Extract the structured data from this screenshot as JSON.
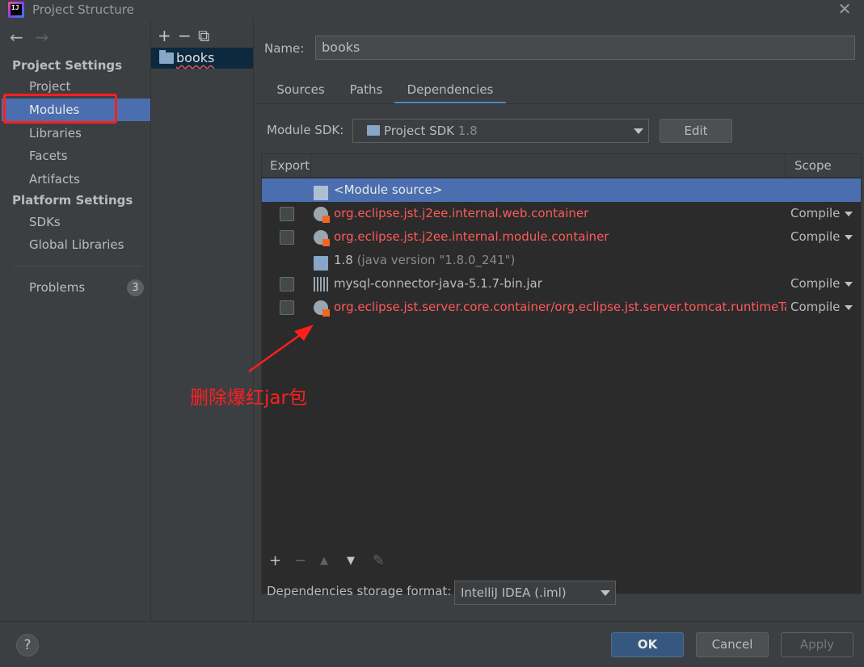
{
  "window": {
    "title": "Project Structure",
    "app_icon_text": "IJ"
  },
  "nav": {
    "back": "←",
    "forward": "→"
  },
  "sidebar": {
    "project_settings_header": "Project Settings",
    "platform_settings_header": "Platform Settings",
    "items": [
      {
        "label": "Project"
      },
      {
        "label": "Modules"
      },
      {
        "label": "Libraries"
      },
      {
        "label": "Facets"
      },
      {
        "label": "Artifacts"
      },
      {
        "label": "SDKs"
      },
      {
        "label": "Global Libraries"
      },
      {
        "label": "Problems"
      }
    ],
    "problems_count": "3"
  },
  "module_tree": {
    "toolbar": {
      "add": "+",
      "remove": "−",
      "copy": "⧉"
    },
    "items": [
      {
        "label": "books"
      }
    ]
  },
  "module": {
    "name_label": "Name:",
    "name_value": "books",
    "tabs": [
      {
        "label": "Sources"
      },
      {
        "label": "Paths"
      },
      {
        "label": "Dependencies"
      }
    ],
    "sdk_label": "Module SDK:",
    "sdk_value": "Project SDK",
    "sdk_version": "1.8",
    "edit_label": "Edit"
  },
  "deps_table": {
    "headers": {
      "export": "Export",
      "scope": "Scope"
    },
    "rows": [
      {
        "name": "<Module source>",
        "scope": ""
      },
      {
        "name": "org.eclipse.jst.j2ee.internal.web.container",
        "scope": "Compile"
      },
      {
        "name": "org.eclipse.jst.j2ee.internal.module.container",
        "scope": "Compile"
      },
      {
        "name": "1.8",
        "detail": "(java version \"1.8.0_241\")",
        "scope": ""
      },
      {
        "name": "mysql-connector-java-5.1.7-bin.jar",
        "scope": "Compile"
      },
      {
        "name": "org.eclipse.jst.server.core.container/org.eclipse.jst.server.tomcat.runtimeTarget",
        "scope": "Compile"
      }
    ],
    "toolbar": {
      "add": "+",
      "remove": "−",
      "up": "▲",
      "down": "▼",
      "edit": "✎"
    }
  },
  "storage": {
    "label": "Dependencies storage format:",
    "value": "IntelliJ IDEA (.iml)"
  },
  "annotation": {
    "text": "删除爆红jar包"
  },
  "buttons": {
    "help": "?",
    "ok": "OK",
    "cancel": "Cancel",
    "apply": "Apply"
  },
  "colors": {
    "selection": "#4b6eaf",
    "error_text": "#ff5a5a",
    "annotation": "#ff1f1f",
    "ok_button": "#365880"
  }
}
